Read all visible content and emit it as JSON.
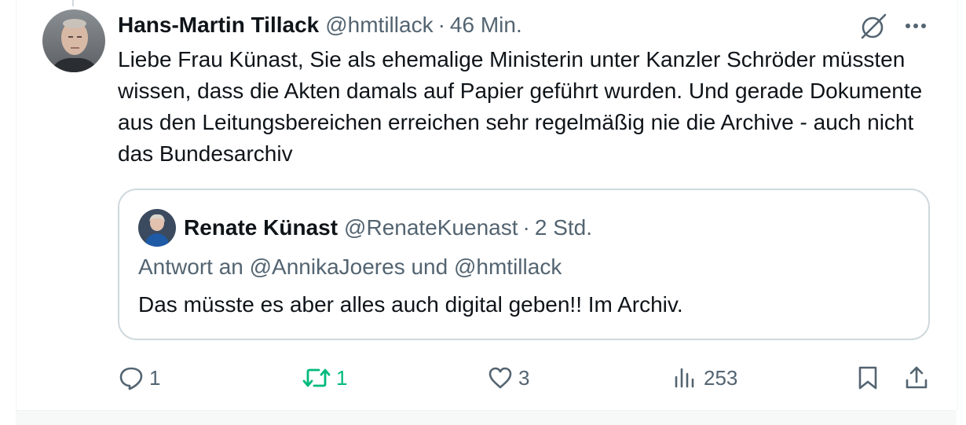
{
  "tweet": {
    "author_name": "Hans-Martin Tillack",
    "handle": "@hmtillack",
    "separator": "·",
    "time": "46 Min.",
    "text": "Liebe Frau Künast, Sie als ehemalige Ministerin unter Kanzler Schröder müssten wissen, dass die Akten damals auf Papier geführt wurden. Und gerade Dokumente aus den Leitungsbereichen erreichen sehr regelmäßig nie die Archive - auch nicht das Bundesarchiv",
    "quoted": {
      "author_name": "Renate Künast",
      "handle": "@RenateKuenast",
      "separator": "·",
      "time": "2 Std.",
      "reply_line": "Antwort an @AnnikaJoeres und @hmtillack",
      "text": "Das müsste es aber alles auch digital geben!! Im Archiv."
    },
    "actions": {
      "reply_count": "1",
      "retweet_count": "1",
      "like_count": "3",
      "views_count": "253"
    }
  },
  "icons": {
    "grok": "grok-icon",
    "more": "more-icon",
    "reply": "reply-icon",
    "retweet": "retweet-icon",
    "like": "heart-icon",
    "views": "views-icon",
    "bookmark": "bookmark-icon",
    "share": "share-icon"
  },
  "colors": {
    "text_primary": "#0f1419",
    "text_secondary": "#536471",
    "retweet_active": "#00ba7c",
    "border": "#cfd9de"
  }
}
